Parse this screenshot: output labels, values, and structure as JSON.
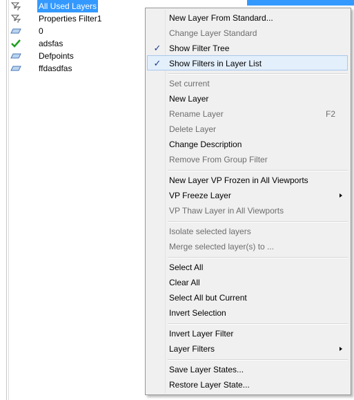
{
  "tree": {
    "items": [
      {
        "label": "All Used Layers",
        "icon": "filter-icon",
        "selected": true
      },
      {
        "label": "Properties Filter1",
        "icon": "filter-icon",
        "selected": false
      },
      {
        "label": "0",
        "icon": "layer-icon",
        "selected": false
      },
      {
        "label": "adsfas",
        "icon": "current-layer-check-icon",
        "selected": false
      },
      {
        "label": "Defpoints",
        "icon": "layer-icon",
        "selected": false
      },
      {
        "label": "ffdasdfas",
        "icon": "layer-icon",
        "selected": false
      }
    ]
  },
  "context_menu": {
    "items": {
      "new_layer_from_standard": "New Layer From Standard...",
      "change_layer_standard": "Change Layer Standard",
      "show_filter_tree": "Show Filter Tree",
      "show_filters_in_layer_list": "Show Filters in Layer List",
      "set_current": "Set current",
      "new_layer": "New Layer",
      "rename_layer": "Rename Layer",
      "rename_layer_shortcut": "F2",
      "delete_layer": "Delete Layer",
      "change_description": "Change Description",
      "remove_from_group_filter": "Remove From Group Filter",
      "new_layer_vp_frozen": "New Layer VP Frozen in All Viewports",
      "vp_freeze_layer": "VP Freeze Layer",
      "vp_thaw_layer": "VP Thaw Layer in All Viewports",
      "isolate_selected_layers": "Isolate selected layers",
      "merge_selected_layers": "Merge selected layer(s) to ...",
      "select_all": "Select All",
      "clear_all": "Clear All",
      "select_all_but_current": "Select All but Current",
      "invert_selection": "Invert Selection",
      "invert_layer_filter": "Invert Layer Filter",
      "layer_filters": "Layer Filters",
      "save_layer_states": "Save Layer States...",
      "restore_layer_state": "Restore Layer State..."
    },
    "check_mark": "✓"
  },
  "colors": {
    "selection": "#3399ff",
    "menu_background": "#f0f0f0",
    "menu_hover": "#e3effb",
    "disabled_text": "#6d6d6d",
    "check_green": "#1e9e1e"
  }
}
